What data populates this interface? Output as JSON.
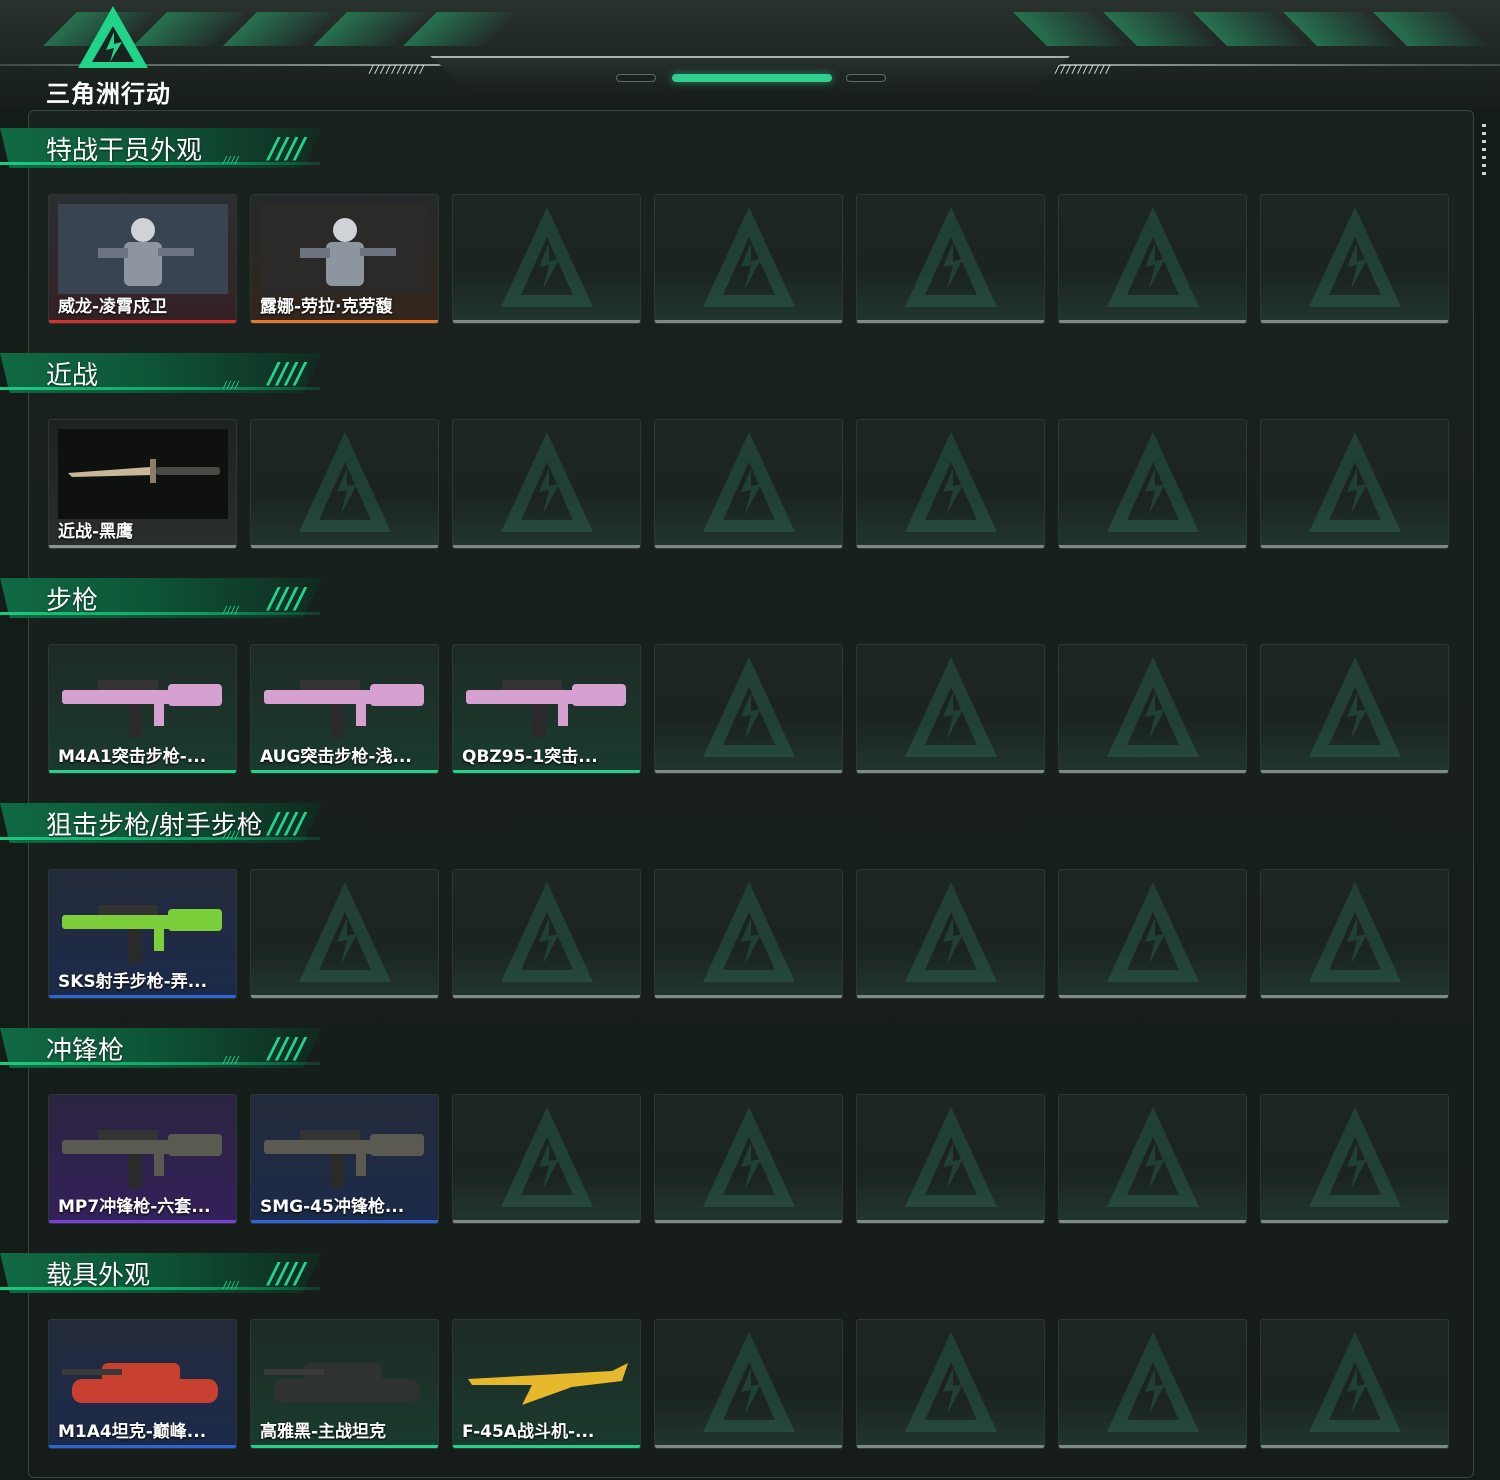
{
  "header": {
    "logo_text": "三角洲行动",
    "accent_color": "#2fd08f"
  },
  "sections": [
    {
      "title": "特战干员外观",
      "items": [
        {
          "label": "威龙-凌霄戍卫",
          "rarity_color": "red",
          "icon": "operator-skin-icon"
        },
        {
          "label": "露娜-劳拉·克劳馥",
          "rarity_color": "orange",
          "icon": "operator-skin-icon"
        }
      ]
    },
    {
      "title": "近战",
      "items": [
        {
          "label": "近战-黑鹰",
          "rarity_color": "gray",
          "icon": "knife-icon"
        }
      ]
    },
    {
      "title": "步枪",
      "items": [
        {
          "label": "M4A1突击步枪-...",
          "rarity_color": "green",
          "icon": "rifle-icon"
        },
        {
          "label": "AUG突击步枪-浅...",
          "rarity_color": "green",
          "icon": "rifle-icon"
        },
        {
          "label": "QBZ95-1突击...",
          "rarity_color": "green",
          "icon": "rifle-icon"
        }
      ]
    },
    {
      "title": "狙击步枪/射手步枪",
      "items": [
        {
          "label": "SKS射手步枪-弄...",
          "rarity_color": "blue",
          "icon": "marksman-rifle-icon"
        }
      ]
    },
    {
      "title": "冲锋枪",
      "items": [
        {
          "label": "MP7冲锋枪-六套...",
          "rarity_color": "purple",
          "icon": "smg-icon"
        },
        {
          "label": "SMG-45冲锋枪...",
          "rarity_color": "blue",
          "icon": "smg-icon"
        }
      ]
    },
    {
      "title": "载具外观",
      "items": [
        {
          "label": "M1A4坦克-巅峰...",
          "rarity_color": "blue",
          "icon": "tank-icon"
        },
        {
          "label": "高雅黑-主战坦克",
          "rarity_color": "green",
          "icon": "tank-icon"
        },
        {
          "label": "F-45A战斗机-...",
          "rarity_color": "green",
          "icon": "fighter-jet-icon"
        }
      ]
    }
  ]
}
